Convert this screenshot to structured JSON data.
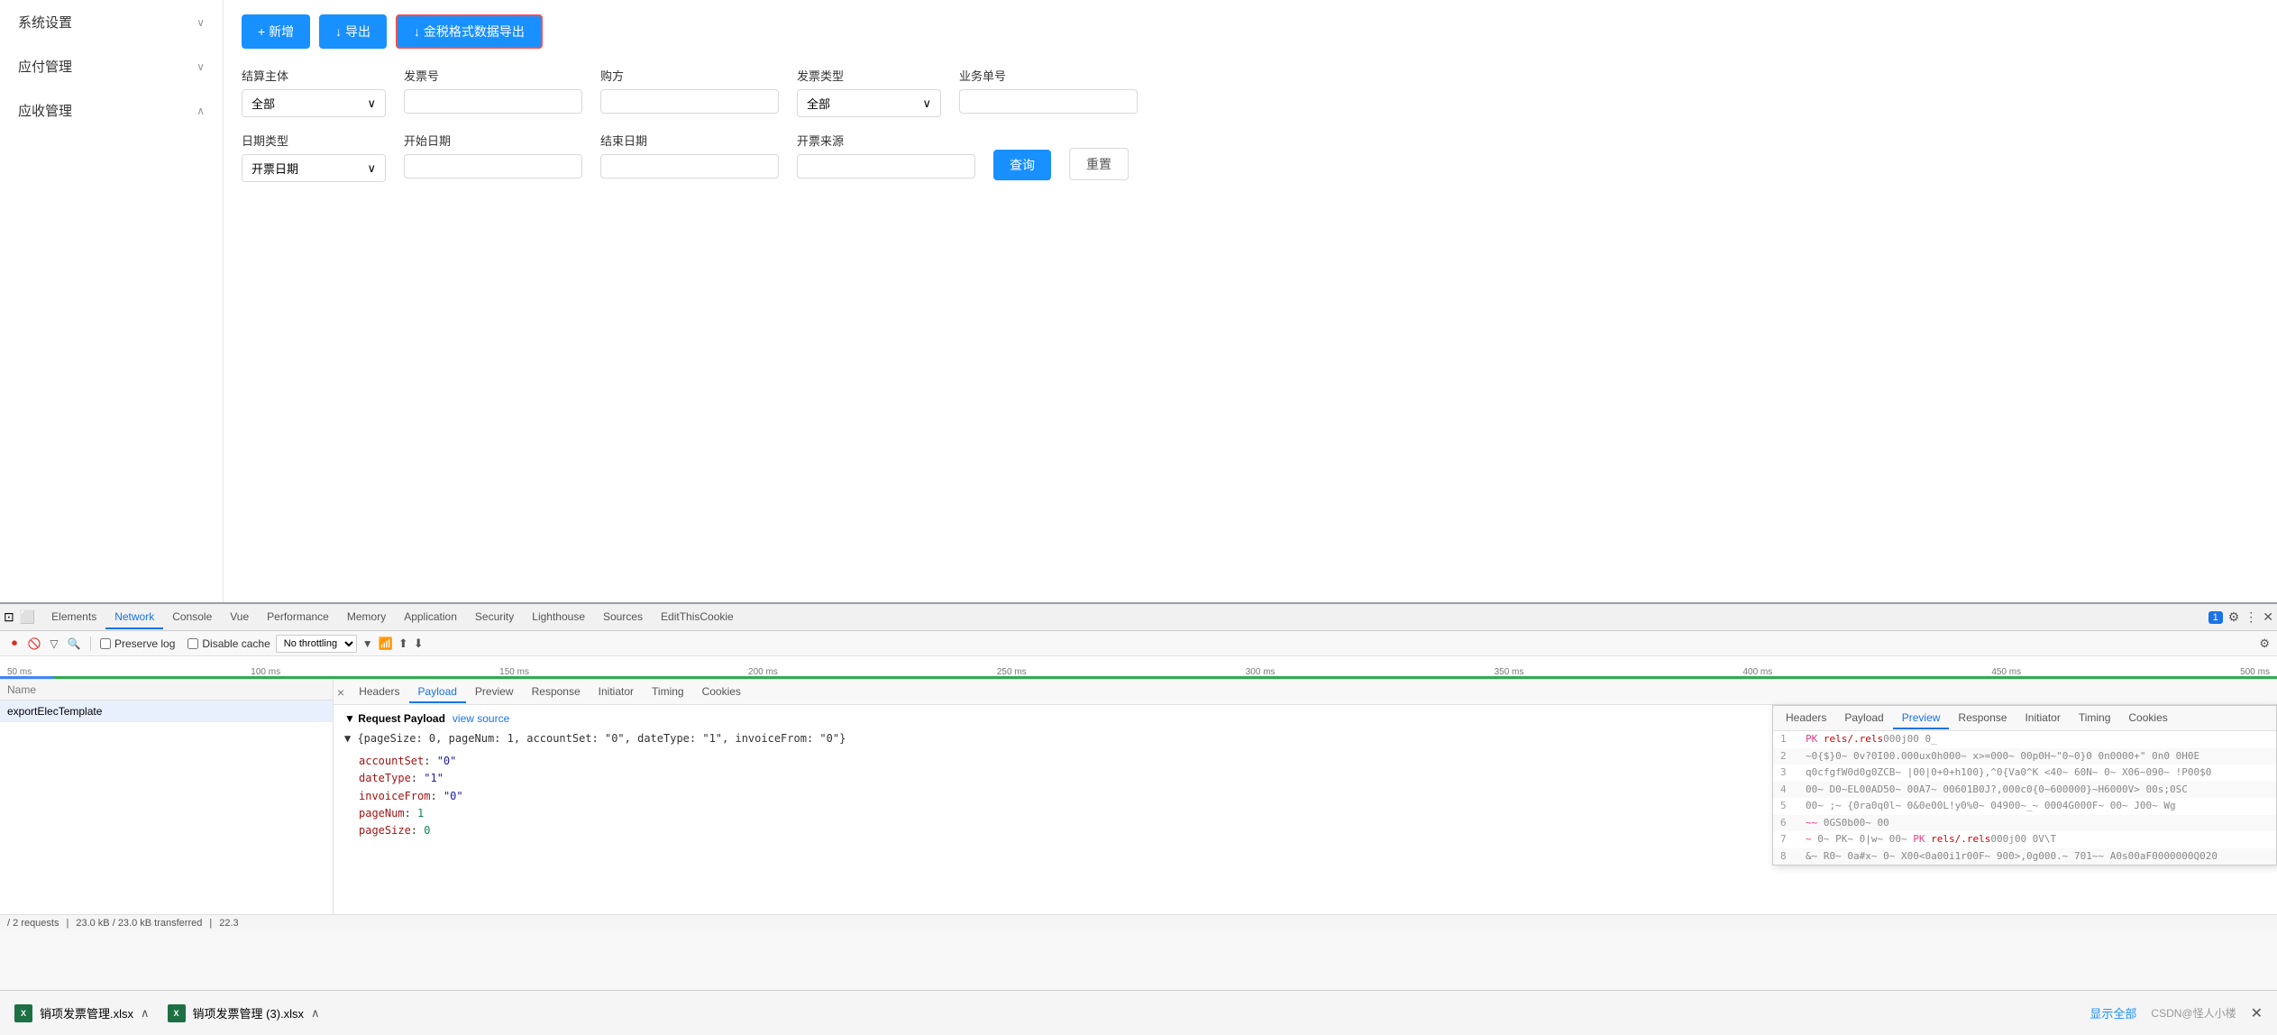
{
  "sidebar": {
    "items": [
      {
        "label": "系统设置",
        "hasArrow": true,
        "expanded": false
      },
      {
        "label": "应付管理",
        "hasArrow": true,
        "expanded": false
      },
      {
        "label": "应收管理",
        "hasArrow": true,
        "expanded": true
      }
    ]
  },
  "toolbar": {
    "add_label": "+ 新增",
    "export_label": "↓ 导出",
    "gold_export_label": "↓ 金税格式数据导出"
  },
  "filters": {
    "settlement_label": "结算主体",
    "invoice_no_label": "发票号",
    "buyer_label": "购方",
    "invoice_type_label": "发票类型",
    "business_no_label": "业务单号",
    "date_type_label": "日期类型",
    "start_date_label": "开始日期",
    "end_date_label": "结束日期",
    "invoice_source_label": "开票来源",
    "all_text": "全部",
    "date_type_value": "开票日期"
  },
  "devtools": {
    "tabs": [
      {
        "label": "Elements",
        "active": false
      },
      {
        "label": "Network",
        "active": true
      },
      {
        "label": "Console",
        "active": false
      },
      {
        "label": "Vue",
        "active": false
      },
      {
        "label": "Performance",
        "active": false
      },
      {
        "label": "Memory",
        "active": false
      },
      {
        "label": "Application",
        "active": false
      },
      {
        "label": "Security",
        "active": false
      },
      {
        "label": "Lighthouse",
        "active": false
      },
      {
        "label": "Sources",
        "active": false
      },
      {
        "label": "EditThisCookie",
        "active": false
      }
    ],
    "badge_count": "1",
    "toolbar": {
      "preserve_log": "Preserve log",
      "disable_cache": "Disable cache",
      "throttle": "No throttling"
    },
    "timeline_labels": [
      "50 ms",
      "100 ms",
      "150 ms",
      "200 ms",
      "250 ms",
      "300 ms",
      "350 ms",
      "400 ms",
      "450 ms",
      "500 ms"
    ]
  },
  "network_panel": {
    "name_header": "Name",
    "list_item": "exportElecTemplate",
    "detail_tabs": [
      {
        "label": "×",
        "is_close": true
      },
      {
        "label": "Headers",
        "active": false
      },
      {
        "label": "Payload",
        "active": true
      },
      {
        "label": "Preview",
        "active": false
      },
      {
        "label": "Response",
        "active": false
      },
      {
        "label": "Initiator",
        "active": false
      },
      {
        "label": "Timing",
        "active": false
      },
      {
        "label": "Cookies",
        "active": false
      }
    ],
    "payload": {
      "title": "▼ Request Payload",
      "view_source": "view source",
      "summary": "▼ {pageSize: 0, pageNum: 1, accountSet: \"0\", dateType: \"1\", invoiceFrom: \"0\"}",
      "fields": [
        {
          "key": "accountSet",
          "value": "\"0\"",
          "type": "string"
        },
        {
          "key": "dateType",
          "value": "\"1\"",
          "type": "string"
        },
        {
          "key": "invoiceFrom",
          "value": "\"0\"",
          "type": "string"
        },
        {
          "key": "pageNum",
          "value": "1",
          "type": "number"
        },
        {
          "key": "pageSize",
          "value": "0",
          "type": "number"
        }
      ]
    },
    "preview_popup": {
      "tabs": [
        "Headers",
        "Payload",
        "Preview",
        "Response",
        "Initiator",
        "Timing",
        "Cookies"
      ],
      "active_tab": "Preview",
      "lines": [
        {
          "num": 1,
          "content": "PK  rels/.rels000j00  0_"
        },
        {
          "num": 2,
          "content": "~0{$}0~ 0v?0I00.000ux0h000~ x>=000~ 00p0H~\"0~0}0    0n0000+\" 0n0  0H0E"
        },
        {
          "num": 3,
          "content": "q0cfgfW0d0g0ZCB~ |00|0+0+h100},^0{Va0^K <40~ 60N~ 0~ X06~090~ !P00$0"
        },
        {
          "num": 4,
          "content": "00~ D0~EL00AD50~ 00A7~ 00601B0J?,000c0{0~600000}~H6000V> 00s;0SC"
        },
        {
          "num": 5,
          "content": "00~ ;~ {0ra0q0l~ 0&0e00L!y0%0~ 04900~_~ 0004G000F~ 00~ J00~ Wg"
        },
        {
          "num": 6,
          "content": "~~ 0GS0b00~ 00"
        },
        {
          "num": 7,
          "content": "~~ 0~ PK~ 0|w~ 00~ PK  rels/.rels000j00  0V\\T"
        },
        {
          "num": 8,
          "content": "&~ R0~ 0a#x~ 0~ X00<0a00i1r00F~ 900>,0g000.~ 701~~ A0s00aF0000000Q020"
        }
      ]
    }
  },
  "status_bar": {
    "requests": "/ 2 requests",
    "transferred": "23.0 kB / 23.0 kB transferred",
    "other": "22.3"
  },
  "download_bar": {
    "files": [
      {
        "name": "销项发票管理.xlsx",
        "has_arrow": true
      },
      {
        "name": "销项发票管理 (3).xlsx",
        "has_arrow": true
      }
    ],
    "show_all": "显示全部",
    "csdn_text": "CSDN@怪人小楼"
  }
}
